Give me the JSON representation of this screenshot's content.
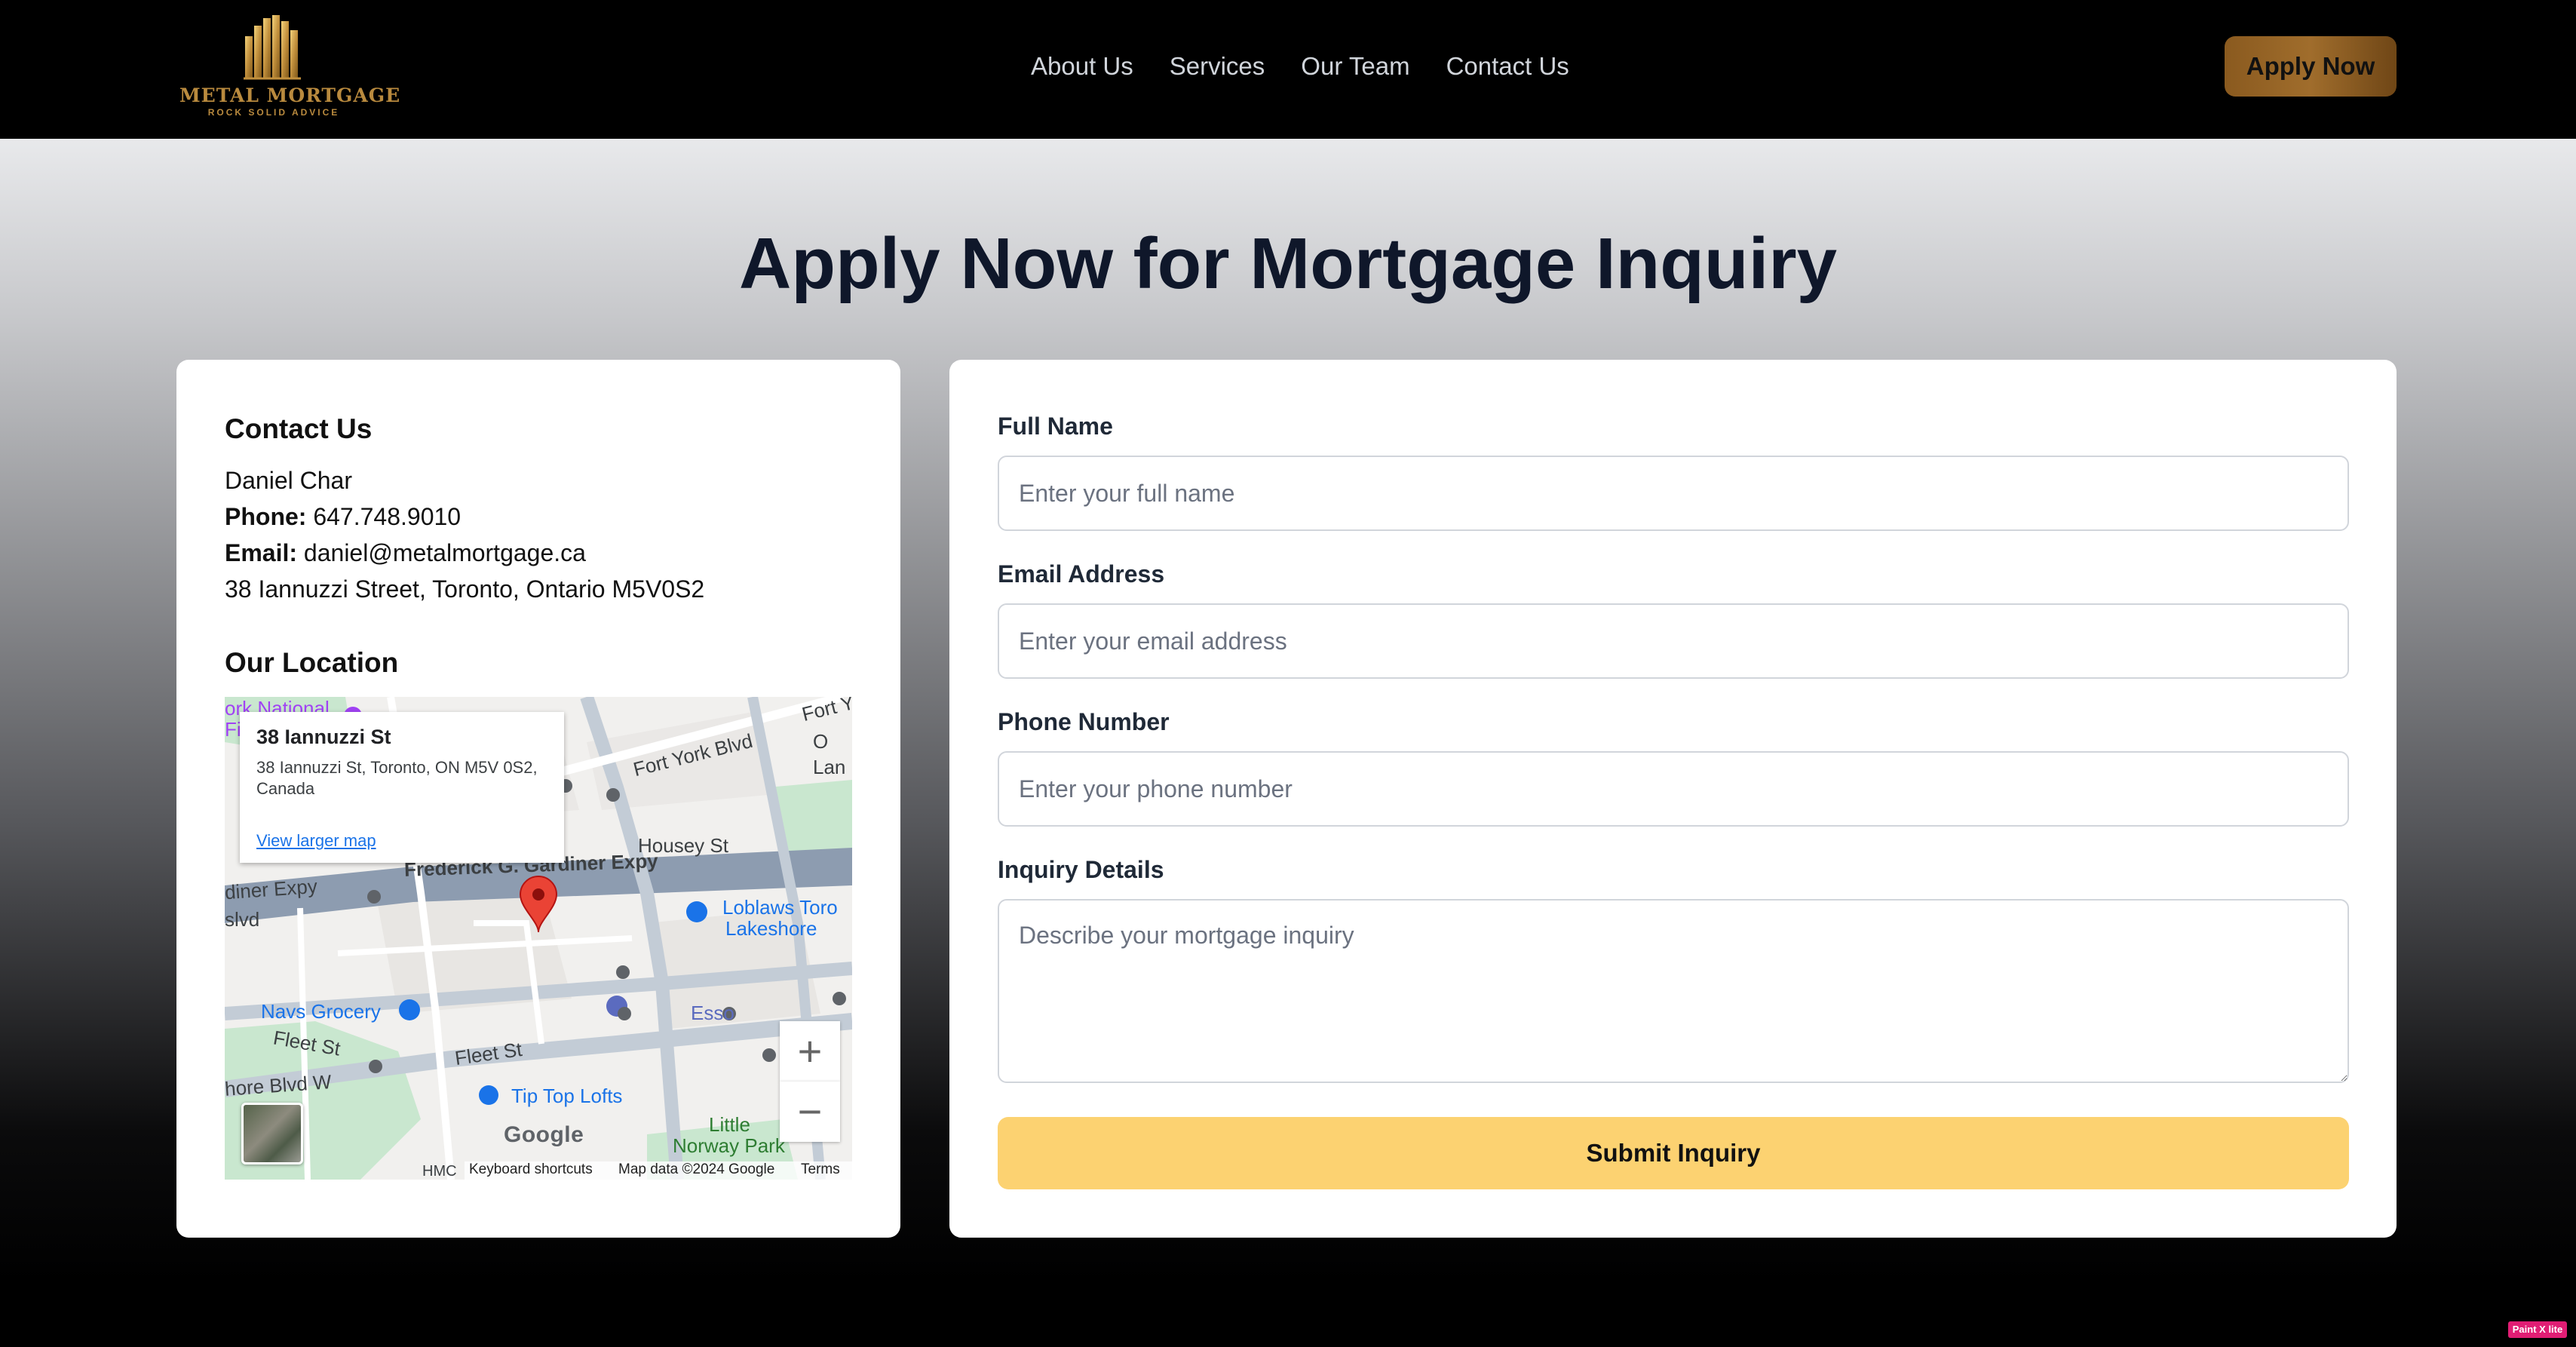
{
  "nav": {
    "logo_title": "METAL MORTGAGE",
    "logo_tagline": "ROCK SOLID ADVICE",
    "links": [
      "About Us",
      "Services",
      "Our Team",
      "Contact Us"
    ],
    "cta": "Apply Now"
  },
  "page": {
    "title": "Apply Now for Mortgage Inquiry"
  },
  "contact": {
    "heading": "Contact Us",
    "name": "Daniel Char",
    "phone_label": "Phone:",
    "phone": "647.748.9010",
    "email_label": "Email:",
    "email": "daniel@metalmortgage.ca",
    "address": "38 Iannuzzi Street, Toronto, Ontario M5V0S2",
    "location_heading": "Our Location"
  },
  "map": {
    "info_title": "38 Iannuzzi St",
    "info_address": "38 Iannuzzi St, Toronto, ON M5V 0S2, Canada",
    "info_link": "View larger map",
    "labels": {
      "fort_york_blvd": "Fort York Blvd",
      "fort_y": "Fort Y",
      "lan": "Lan",
      "york_national": "ork National",
      "fi": "Fi",
      "housey_st": "Housey St",
      "gardiner": "Frederick G. Gardiner Expy",
      "diner_expy": "diner Expy",
      "blvd": "slvd",
      "loblaws_1": "Loblaws Toro",
      "loblaws_2": "Lakeshore",
      "navs_grocery": "Navs Grocery",
      "esso": "Esso",
      "fleet_st_1": "Fleet St",
      "fleet_st_2": "Fleet St",
      "shore_blvd": "hore Blvd W",
      "tip_top": "Tip Top Lofts",
      "little": "Little",
      "norway_park": "Norway Park",
      "hmc": "HMC",
      "o": "O"
    },
    "google": "Google",
    "footer": {
      "shortcuts": "Keyboard shortcuts",
      "data": "Map data ©2024 Google",
      "terms": "Terms"
    },
    "zoom_in": "+",
    "zoom_out": "−"
  },
  "form": {
    "full_name_label": "Full Name",
    "full_name_placeholder": "Enter your full name",
    "email_label": "Email Address",
    "email_placeholder": "Enter your email address",
    "phone_label": "Phone Number",
    "phone_placeholder": "Enter your phone number",
    "inquiry_label": "Inquiry Details",
    "inquiry_placeholder": "Describe your mortgage inquiry",
    "submit": "Submit Inquiry"
  },
  "badge": "Paint X lite",
  "colors": {
    "nav_bg": "#000000",
    "gold": "#b98a3e",
    "submit_bg": "#fcd271",
    "heading": "#0f172a"
  }
}
